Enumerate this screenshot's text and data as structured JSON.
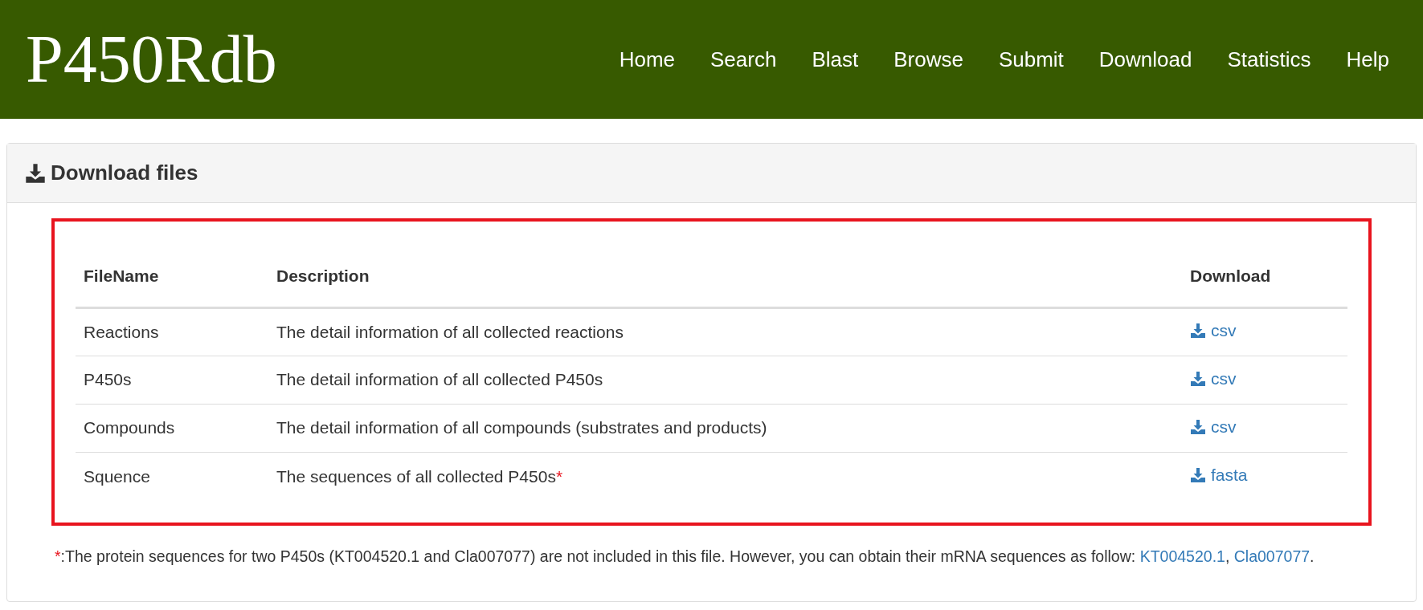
{
  "header": {
    "logo": "P450Rdb",
    "nav": [
      {
        "label": "Home"
      },
      {
        "label": "Search"
      },
      {
        "label": "Blast"
      },
      {
        "label": "Browse"
      },
      {
        "label": "Submit"
      },
      {
        "label": "Download"
      },
      {
        "label": "Statistics"
      },
      {
        "label": "Help"
      }
    ]
  },
  "panel": {
    "title": "Download files",
    "table": {
      "columns": [
        "FileName",
        "Description",
        "Download"
      ],
      "rows": [
        {
          "file": "Reactions",
          "description": "The detail information of all collected reactions",
          "mark": "",
          "link": "csv"
        },
        {
          "file": "P450s",
          "description": "The detail information of all collected P450s",
          "mark": "",
          "link": "csv"
        },
        {
          "file": "Compounds",
          "description": "The detail information of all compounds (substrates and products)",
          "mark": "",
          "link": "csv"
        },
        {
          "file": "Squence",
          "description": "The sequences of all collected P450s",
          "mark": "*",
          "link": "fasta"
        }
      ]
    },
    "footnote": [
      {
        "kind": "mark",
        "text": "*"
      },
      {
        "kind": "text",
        "text": ":The protein sequences for two P450s (KT004520.1 and Cla007077) are not included in this file. However, you can obtain their mRNA sequences as follow:"
      },
      {
        "kind": "link",
        "text": "KT004520.1"
      },
      {
        "kind": "text",
        "text": ","
      },
      {
        "kind": "link",
        "text": "Cla007077"
      },
      {
        "kind": "text",
        "text": "."
      }
    ]
  }
}
